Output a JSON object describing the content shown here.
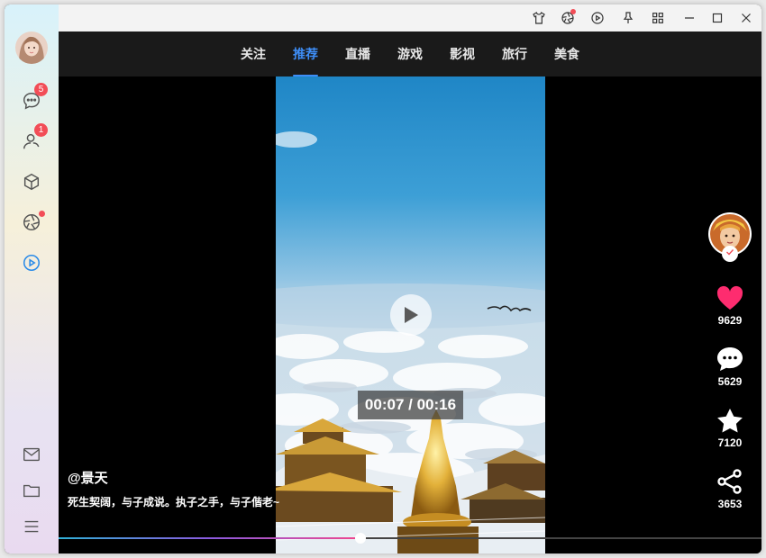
{
  "sidebar": {
    "avatar_icon": "user-avatar",
    "items": [
      {
        "icon": "chat-bubble-icon",
        "badge": "5"
      },
      {
        "icon": "contacts-icon",
        "badge": "1"
      },
      {
        "icon": "cube-icon"
      },
      {
        "icon": "aperture-icon",
        "dot": true
      },
      {
        "icon": "play-circle-icon",
        "active": true
      }
    ],
    "bottom": [
      "mail-icon",
      "folder-icon",
      "menu-icon"
    ]
  },
  "titlebar": {
    "buttons": [
      "skin-icon",
      "aperture-icon",
      "play-circle-icon",
      "pin-icon",
      "grid-icon",
      "minimize-icon",
      "maximize-icon",
      "close-icon"
    ]
  },
  "nav": {
    "tabs": [
      "关注",
      "推荐",
      "直播",
      "游戏",
      "影视",
      "旅行",
      "美食"
    ],
    "active_index": 1
  },
  "video": {
    "time_display": "00:07 / 00:16",
    "author": "@景天",
    "description": "死生契阔，与子成说。执子之手，与子偕老~",
    "progress": 0.43
  },
  "actions": {
    "likes": "9629",
    "comments": "5629",
    "favorites": "7120",
    "shares": "3653"
  },
  "colors": {
    "accent": "#3e8ef7",
    "like": "#fe2c6f",
    "badge": "#f24d57"
  }
}
